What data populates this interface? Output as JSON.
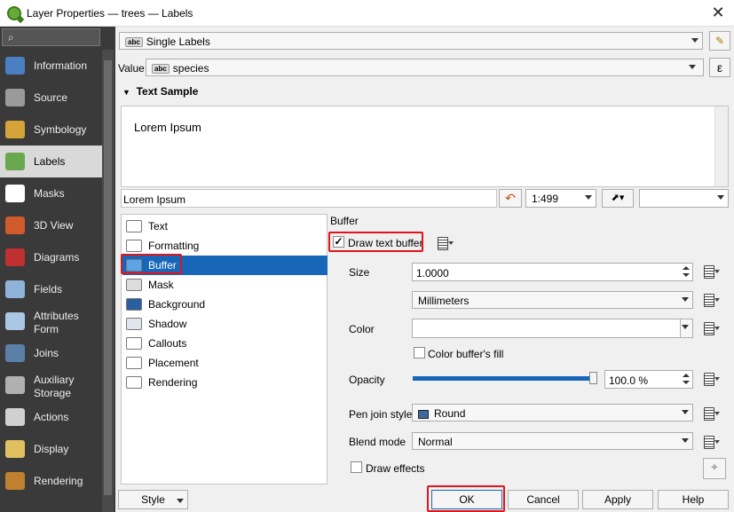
{
  "window": {
    "title": "Layer Properties — trees — Labels"
  },
  "sidebar": {
    "items": [
      {
        "label": "Information",
        "icon": "information-icon",
        "color": "#4a7fc1"
      },
      {
        "label": "Source",
        "icon": "source-icon",
        "color": "#9a9a9a"
      },
      {
        "label": "Symbology",
        "icon": "symbology-icon",
        "color": "#d6a33a"
      },
      {
        "label": "Labels",
        "icon": "labels-icon",
        "color": "#6aa84f"
      },
      {
        "label": "Masks",
        "icon": "masks-icon",
        "color": "#ffffff"
      },
      {
        "label": "3D View",
        "icon": "3d-view-icon",
        "color": "#d05a2a"
      },
      {
        "label": "Diagrams",
        "icon": "diagrams-icon",
        "color": "#c03030"
      },
      {
        "label": "Fields",
        "icon": "fields-icon",
        "color": "#8fb3d9"
      },
      {
        "label": "Attributes Form",
        "icon": "attributes-form-icon",
        "color": "#aac7e6"
      },
      {
        "label": "Joins",
        "icon": "joins-icon",
        "color": "#5c7fa8"
      },
      {
        "label": "Auxiliary Storage",
        "icon": "auxiliary-storage-icon",
        "color": "#b0b0b0"
      },
      {
        "label": "Actions",
        "icon": "actions-icon",
        "color": "#d0d0d0"
      },
      {
        "label": "Display",
        "icon": "display-icon",
        "color": "#e0c060"
      },
      {
        "label": "Rendering",
        "icon": "rendering-icon",
        "color": "#c08030"
      }
    ]
  },
  "labels_mode": {
    "value": "Single Labels"
  },
  "value_field": {
    "label": "Value",
    "value": "species",
    "expr": "ε"
  },
  "text_sample": {
    "heading": "Text Sample",
    "preview": "Lorem Ipsum",
    "input": "Lorem Ipsum",
    "scale": "1:499"
  },
  "sub_tabs": [
    {
      "label": "Text",
      "icon": "text-icon"
    },
    {
      "label": "Formatting",
      "icon": "formatting-icon"
    },
    {
      "label": "Buffer",
      "icon": "buffer-icon"
    },
    {
      "label": "Mask",
      "icon": "mask-icon"
    },
    {
      "label": "Background",
      "icon": "background-icon"
    },
    {
      "label": "Shadow",
      "icon": "shadow-icon"
    },
    {
      "label": "Callouts",
      "icon": "callouts-icon"
    },
    {
      "label": "Placement",
      "icon": "placement-icon"
    },
    {
      "label": "Rendering",
      "icon": "rendering-icon"
    }
  ],
  "buffer": {
    "section_title": "Buffer",
    "draw_text_buffer": "Draw text buffer",
    "size_label": "Size",
    "size_value": "1.0000",
    "unit": "Millimeters",
    "color_label": "Color",
    "color_buffers_fill": "Color buffer's fill",
    "opacity_label": "Opacity",
    "opacity_value": "100.0 %",
    "opacity_fraction": 1.0,
    "pen_join_label": "Pen join style",
    "pen_join_value": "Round",
    "blend_label": "Blend mode",
    "blend_value": "Normal",
    "draw_effects": "Draw effects"
  },
  "buttons": {
    "style": "Style",
    "ok": "OK",
    "cancel": "Cancel",
    "apply": "Apply",
    "help": "Help"
  },
  "colors": {
    "selection": "#1766b8",
    "highlight": "#e0141b",
    "sidebar_bg": "#3a3a3a"
  }
}
